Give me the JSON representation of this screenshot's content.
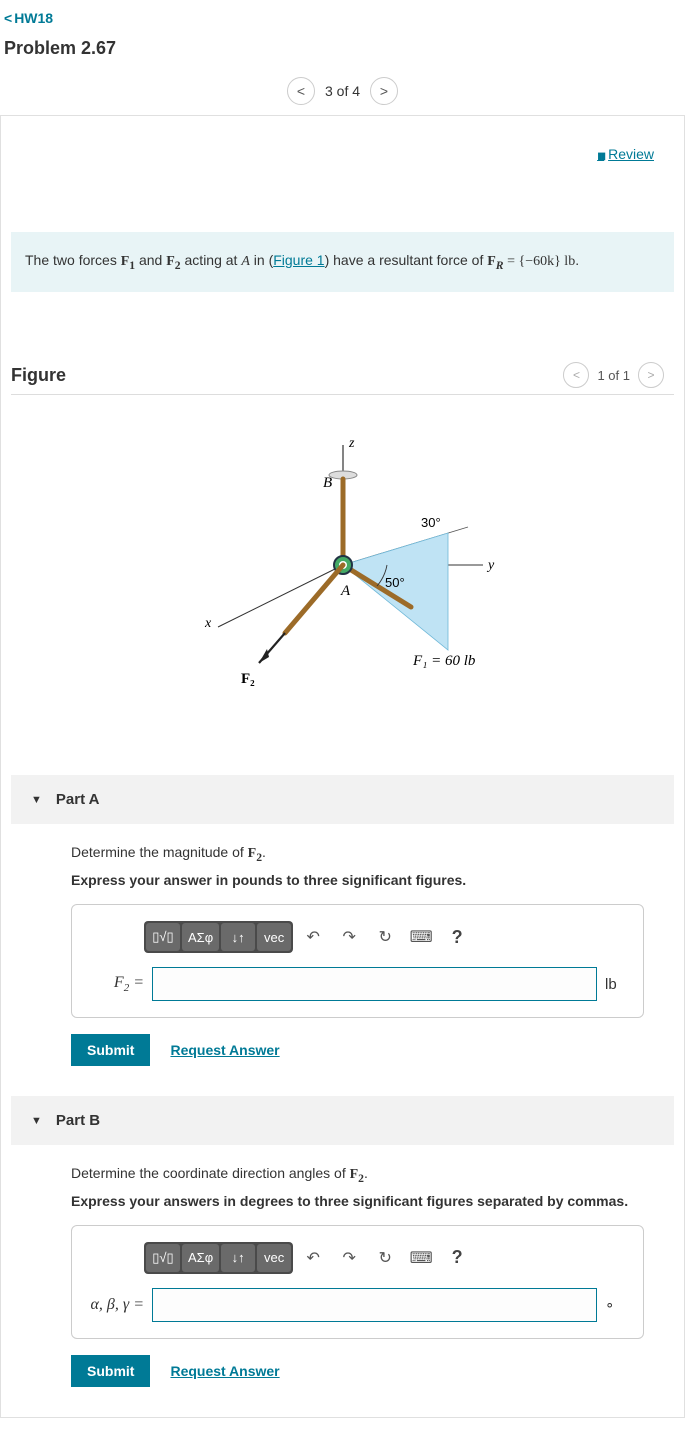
{
  "nav": {
    "back_label": "HW18",
    "problem_title": "Problem 2.67",
    "pager_text": "3 of 4"
  },
  "review_label": "Review",
  "statement": {
    "prefix": "The two forces ",
    "f1": "F",
    "f1sub": "1",
    "mid1": " and ",
    "f2": "F",
    "f2sub": "2",
    "mid2": " acting at ",
    "A": "A",
    "mid3": " in (",
    "fig_link": "Figure 1",
    "mid4": ") have a resultant force of ",
    "FR": "F",
    "FRsub": "R",
    "eq": " = {−60k} lb",
    "suffix": "."
  },
  "figure": {
    "title": "Figure",
    "pager": "1 of 1",
    "labels": {
      "z": "z",
      "y": "y",
      "x": "x",
      "A": "A",
      "B": "B",
      "ang30": "30°",
      "ang50": "50°",
      "F1eq": "F₁ = 60 lb",
      "F2": "F₂"
    }
  },
  "partA": {
    "title": "Part A",
    "question_pre": "Determine the magnitude of ",
    "question_var": "F",
    "question_sub": "2",
    "question_post": ".",
    "instruction": "Express your answer in pounds to three significant figures.",
    "var_label_html": "F<sub>2</sub> =",
    "unit": "lb",
    "submit": "Submit",
    "request": "Request Answer"
  },
  "partB": {
    "title": "Part B",
    "question_pre": "Determine the coordinate direction angles of ",
    "question_var": "F",
    "question_sub": "2",
    "question_post": ".",
    "instruction": "Express your answers in degrees to three significant figures separated by commas.",
    "var_label": "α, β, γ =",
    "unit": "∘",
    "submit": "Submit",
    "request": "Request Answer"
  },
  "toolbar": {
    "templates": "▯√▯",
    "greek": "ΑΣφ",
    "subsup": "↓↑",
    "vec": "vec",
    "undo": "↶",
    "redo": "↷",
    "reset": "↻",
    "keyboard": "⌨",
    "help": "?"
  }
}
